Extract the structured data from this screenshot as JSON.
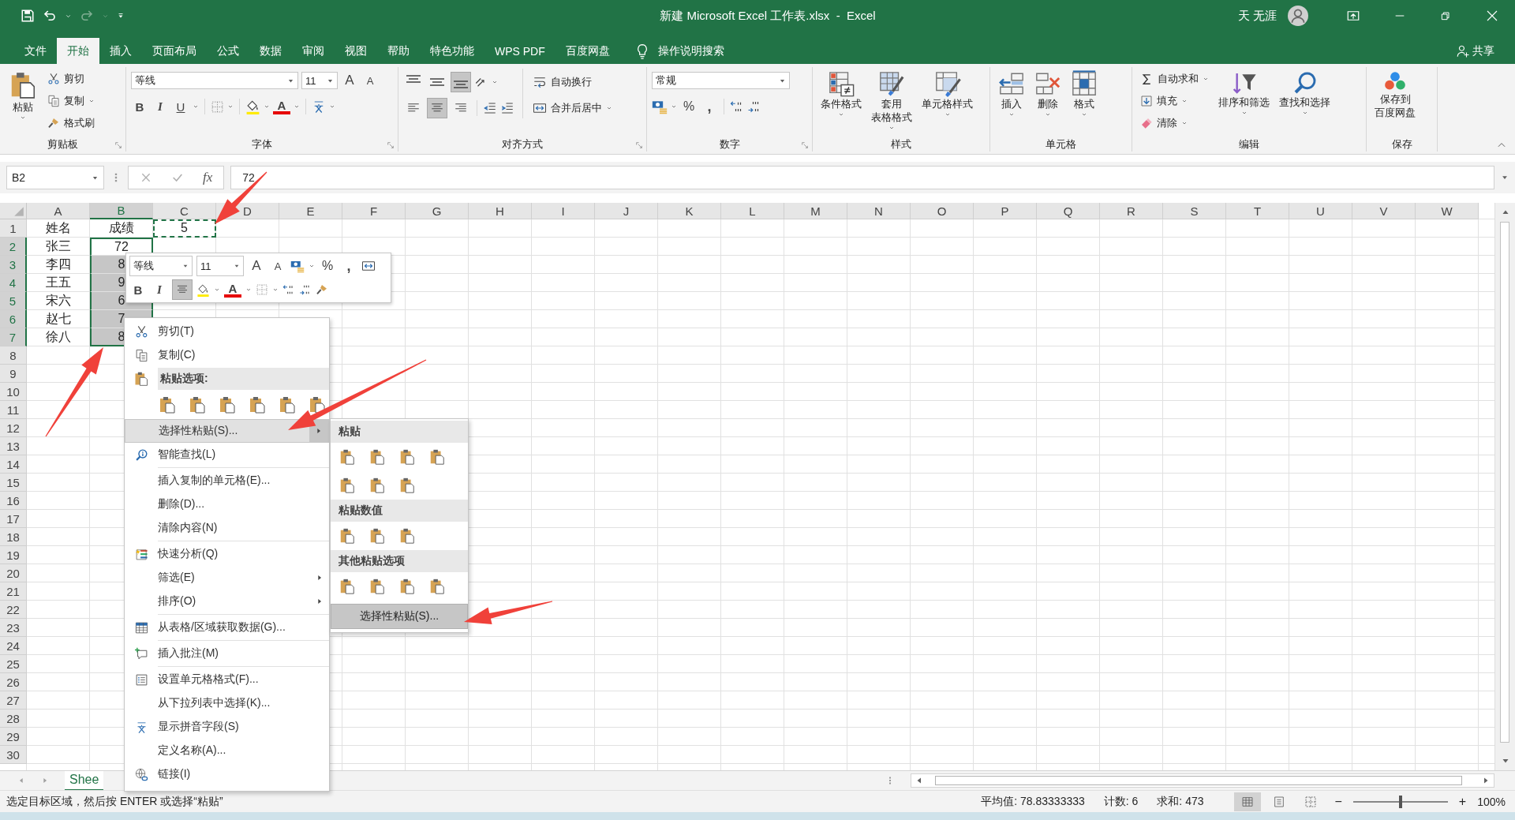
{
  "title_bar": {
    "title": "新建 Microsoft Excel 工作表.xlsx  -  Excel",
    "user": "天 无涯"
  },
  "ribbon_tabs": [
    {
      "label": "文件",
      "selected": false
    },
    {
      "label": "开始",
      "selected": true
    },
    {
      "label": "插入",
      "selected": false
    },
    {
      "label": "页面布局",
      "selected": false
    },
    {
      "label": "公式",
      "selected": false
    },
    {
      "label": "数据",
      "selected": false
    },
    {
      "label": "审阅",
      "selected": false
    },
    {
      "label": "视图",
      "selected": false
    },
    {
      "label": "帮助",
      "selected": false
    },
    {
      "label": "特色功能",
      "selected": false
    },
    {
      "label": "WPS PDF",
      "selected": false
    },
    {
      "label": "百度网盘",
      "selected": false
    }
  ],
  "tell_me": "操作说明搜索",
  "share": "共享",
  "ribbon": {
    "clipboard": {
      "label": "剪贴板",
      "paste": "粘贴",
      "cut": "剪切",
      "copy": "复制",
      "format_painter": "格式刷"
    },
    "font": {
      "label": "字体",
      "font_name": "等线",
      "font_size": "11",
      "grow": "A",
      "shrink": "A",
      "bold": "B",
      "italic": "I",
      "underline": "U",
      "font_color": "A"
    },
    "alignment": {
      "label": "对齐方式",
      "vertical": [
        {
          "selected": false
        },
        {
          "selected": false
        },
        {
          "selected": true
        }
      ],
      "horizontal": [
        {
          "selected": false
        },
        {
          "selected": true
        },
        {
          "selected": false
        }
      ],
      "wrap_text": "自动换行",
      "merge_center": "合并后居中"
    },
    "number": {
      "label": "数字",
      "format": "常规",
      "percent": "%",
      "comma": ","
    },
    "styles": {
      "label": "样式",
      "conditional": [
        "条件格式"
      ],
      "table": [
        "套用",
        "表格格式"
      ],
      "cell_styles": [
        "单元格样式"
      ]
    },
    "cells": {
      "label": "单元格",
      "insert": "插入",
      "delete": "删除",
      "format": "格式"
    },
    "editing": {
      "label": "编辑",
      "autosum": "自动求和",
      "fill": "填充",
      "clear": "清除",
      "sort_filter": "排序和筛选",
      "find_select": "查找和选择"
    },
    "save": {
      "label": "保存",
      "save_to": [
        "保存到",
        "百度网盘"
      ]
    }
  },
  "formula_bar": {
    "name_box": "B2",
    "fx": "fx",
    "value": "72"
  },
  "columns": [
    {
      "letter": "A",
      "selected": false
    },
    {
      "letter": "B",
      "selected": true
    },
    {
      "letter": "C",
      "selected": false
    },
    {
      "letter": "D",
      "selected": false
    },
    {
      "letter": "E",
      "selected": false
    },
    {
      "letter": "F",
      "selected": false
    },
    {
      "letter": "G",
      "selected": false
    },
    {
      "letter": "H",
      "selected": false
    },
    {
      "letter": "I",
      "selected": false
    },
    {
      "letter": "J",
      "selected": false
    },
    {
      "letter": "K",
      "selected": false
    },
    {
      "letter": "L",
      "selected": false
    },
    {
      "letter": "M",
      "selected": false
    },
    {
      "letter": "N",
      "selected": false
    },
    {
      "letter": "O",
      "selected": false
    },
    {
      "letter": "P",
      "selected": false
    },
    {
      "letter": "Q",
      "selected": false
    },
    {
      "letter": "R",
      "selected": false
    },
    {
      "letter": "S",
      "selected": false
    },
    {
      "letter": "T",
      "selected": false
    },
    {
      "letter": "U",
      "selected": false
    },
    {
      "letter": "V",
      "selected": false
    },
    {
      "letter": "W",
      "selected": false
    }
  ],
  "rows": [
    {
      "number": "1",
      "selected": false,
      "cells": [
        {
          "text": "姓名",
          "kind": "normal"
        },
        {
          "text": "成绩",
          "kind": "normal"
        },
        {
          "text": "5",
          "kind": "copied"
        }
      ]
    },
    {
      "number": "2",
      "selected": true,
      "cells": [
        {
          "text": "张三",
          "kind": "normal"
        },
        {
          "text": "72",
          "kind": "active"
        }
      ]
    },
    {
      "number": "3",
      "selected": true,
      "cells": [
        {
          "text": "李四",
          "kind": "normal"
        },
        {
          "text": "8",
          "kind": "selected"
        }
      ]
    },
    {
      "number": "4",
      "selected": true,
      "cells": [
        {
          "text": "王五",
          "kind": "normal"
        },
        {
          "text": "9",
          "kind": "selected"
        }
      ]
    },
    {
      "number": "5",
      "selected": true,
      "cells": [
        {
          "text": "宋六",
          "kind": "normal"
        },
        {
          "text": "6",
          "kind": "selected"
        }
      ]
    },
    {
      "number": "6",
      "selected": true,
      "cells": [
        {
          "text": "赵七",
          "kind": "normal"
        },
        {
          "text": "7",
          "kind": "selected"
        }
      ]
    },
    {
      "number": "7",
      "selected": true,
      "cells": [
        {
          "text": "徐八",
          "kind": "normal"
        },
        {
          "text": "8",
          "kind": "selected"
        }
      ]
    },
    {
      "number": "8",
      "selected": false
    },
    {
      "number": "9",
      "selected": false
    },
    {
      "number": "10",
      "selected": false
    },
    {
      "number": "11",
      "selected": false
    },
    {
      "number": "12",
      "selected": false
    },
    {
      "number": "13",
      "selected": false
    },
    {
      "number": "14",
      "selected": false
    },
    {
      "number": "15",
      "selected": false
    },
    {
      "number": "16",
      "selected": false
    },
    {
      "number": "17",
      "selected": false
    },
    {
      "number": "18",
      "selected": false
    },
    {
      "number": "19",
      "selected": false
    },
    {
      "number": "20",
      "selected": false
    },
    {
      "number": "21",
      "selected": false
    },
    {
      "number": "22",
      "selected": false
    },
    {
      "number": "23",
      "selected": false
    },
    {
      "number": "24",
      "selected": false
    },
    {
      "number": "25",
      "selected": false
    },
    {
      "number": "26",
      "selected": false
    },
    {
      "number": "27",
      "selected": false
    },
    {
      "number": "28",
      "selected": false
    },
    {
      "number": "29",
      "selected": false
    },
    {
      "number": "30",
      "selected": false
    }
  ],
  "mini_toolbar": {
    "font_name": "等线",
    "font_size": "11",
    "grow": "A",
    "shrink": "A",
    "percent": "%",
    "comma": ",",
    "bold": "B",
    "italic": "I",
    "align_center": {
      "selected": true
    },
    "font_color": "A"
  },
  "context_menu": {
    "items": [
      {
        "kind": "item",
        "label": "剪切(T)",
        "submenu": false,
        "selected": false
      },
      {
        "kind": "item",
        "label": "复制(C)",
        "submenu": false,
        "selected": false
      },
      {
        "kind": "header",
        "label": "粘贴选项:"
      },
      {
        "kind": "icons"
      },
      {
        "kind": "item",
        "label": "选择性粘贴(S)...",
        "submenu": true,
        "selected": true
      },
      {
        "kind": "item",
        "label": "智能查找(L)",
        "submenu": false,
        "selected": false
      },
      {
        "kind": "separator"
      },
      {
        "kind": "item",
        "label": "插入复制的单元格(E)...",
        "submenu": false,
        "selected": false
      },
      {
        "kind": "item",
        "label": "删除(D)...",
        "submenu": false,
        "selected": false
      },
      {
        "kind": "item",
        "label": "清除内容(N)",
        "submenu": false,
        "selected": false
      },
      {
        "kind": "separator"
      },
      {
        "kind": "item",
        "label": "快速分析(Q)",
        "submenu": false,
        "selected": false
      },
      {
        "kind": "item",
        "label": "筛选(E)",
        "submenu": true,
        "selected": false
      },
      {
        "kind": "item",
        "label": "排序(O)",
        "submenu": true,
        "selected": false
      },
      {
        "kind": "separator"
      },
      {
        "kind": "item",
        "label": "从表格/区域获取数据(G)...",
        "submenu": false,
        "selected": false
      },
      {
        "kind": "separator"
      },
      {
        "kind": "item",
        "label": "插入批注(M)",
        "submenu": false,
        "selected": false
      },
      {
        "kind": "separator"
      },
      {
        "kind": "item",
        "label": "设置单元格格式(F)...",
        "submenu": false,
        "selected": false
      },
      {
        "kind": "item",
        "label": "从下拉列表中选择(K)...",
        "submenu": false,
        "selected": false
      },
      {
        "kind": "item",
        "label": "显示拼音字段(S)",
        "submenu": false,
        "selected": false
      },
      {
        "kind": "item",
        "label": "定义名称(A)...",
        "submenu": false,
        "selected": false
      },
      {
        "kind": "item",
        "label": "链接(I)",
        "submenu": false,
        "selected": false
      }
    ]
  },
  "submenu": {
    "items": [
      {
        "kind": "header",
        "label": "粘贴"
      },
      {
        "kind": "icons"
      },
      {
        "kind": "icons"
      },
      {
        "kind": "header",
        "label": "粘贴数值"
      },
      {
        "kind": "icons"
      },
      {
        "kind": "header",
        "label": "其他粘贴选项"
      },
      {
        "kind": "icons"
      },
      {
        "kind": "item",
        "label": "选择性粘贴(S)...",
        "selected": true
      }
    ]
  },
  "sheet_tabs": [
    {
      "label": "Shee",
      "selected": true
    }
  ],
  "status_bar": {
    "message": "选定目标区域，然后按 ENTER 或选择“粘贴”",
    "average": "平均值: 78.83333333",
    "count": "计数: 6",
    "sum": "求和: 473",
    "views": [
      {
        "selected": true
      },
      {
        "selected": false
      },
      {
        "selected": false
      }
    ],
    "zoom": {
      "minus": "−",
      "plus": "+",
      "level": 0.5,
      "percent": "100%"
    }
  }
}
